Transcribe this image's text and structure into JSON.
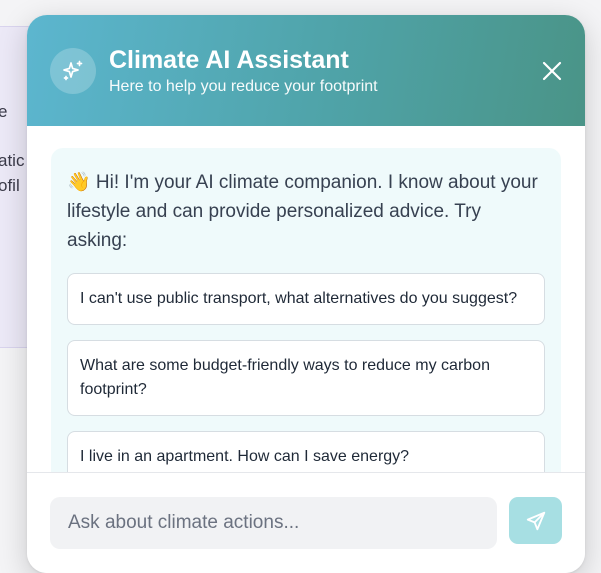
{
  "background": {
    "text_fragments": [
      "e",
      "atic",
      "ofil"
    ]
  },
  "header": {
    "icon": "sparkles-icon",
    "title": "Climate AI Assistant",
    "subtitle": "Here to help you reduce your footprint",
    "close_icon": "close-icon"
  },
  "message": {
    "greeting": "👋 Hi! I'm your AI climate companion. I know about your lifestyle and can provide personalized advice. Try asking:",
    "suggestions": [
      "I can't use public transport, what alternatives do you suggest?",
      "What are some budget-friendly ways to reduce my carbon footprint?",
      "I live in an apartment. How can I save energy?"
    ]
  },
  "input": {
    "placeholder": "Ask about climate actions...",
    "value": "",
    "send_icon": "send-icon"
  },
  "colors": {
    "header_gradient_start": "#5cb6cf",
    "header_gradient_end": "#4a9487",
    "bubble_bg": "#effafb",
    "send_button_bg": "#a7dfe3"
  }
}
